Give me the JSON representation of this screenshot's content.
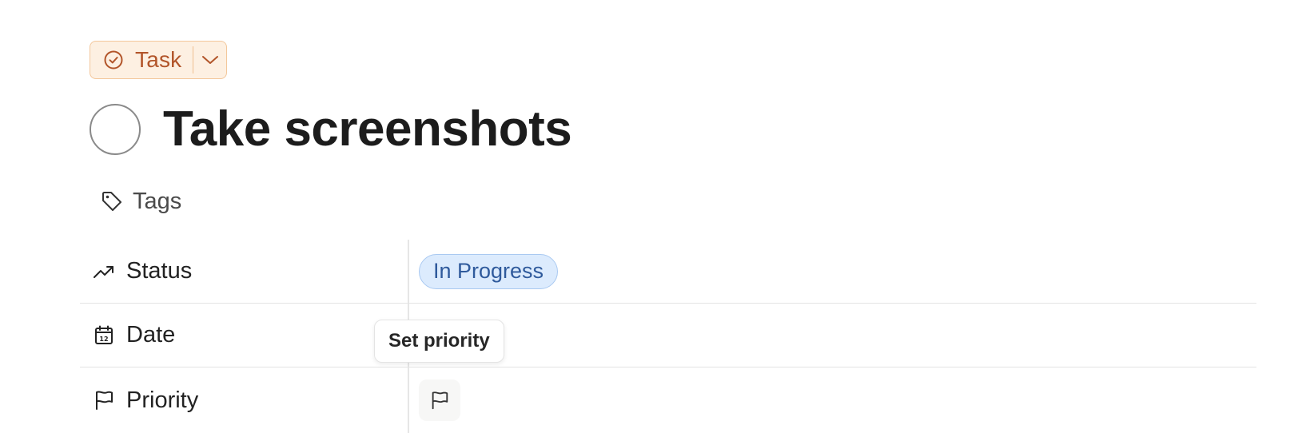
{
  "task_type": {
    "label": "Task",
    "icon": "check-circle-icon",
    "dropdown_icon": "chevron-down-icon",
    "colors": {
      "text": "#b2552a",
      "background": "#fdf0e2",
      "border": "#f3c79b"
    }
  },
  "task": {
    "title": "Take screenshots",
    "completed": false
  },
  "tags": {
    "label": "Tags",
    "icon": "tag-icon"
  },
  "properties": [
    {
      "label": "Status",
      "icon": "trending-up-icon",
      "value": "In Progress"
    },
    {
      "label": "Date",
      "icon": "calendar-icon",
      "value": ""
    },
    {
      "label": "Priority",
      "icon": "flag-icon",
      "value": ""
    }
  ],
  "status_colors": {
    "background": "#dcebfd",
    "border": "#a9c9f1",
    "text": "#2f5a9c"
  },
  "tooltip": {
    "text": "Set priority"
  }
}
